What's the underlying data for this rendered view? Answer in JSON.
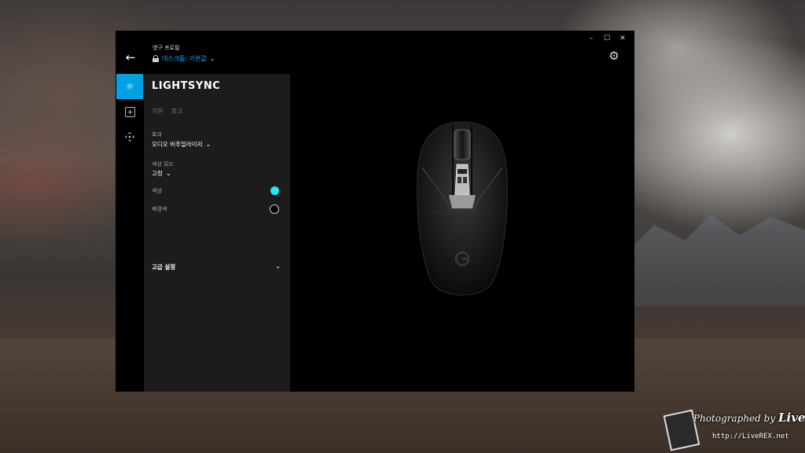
{
  "window": {
    "profile_title": "영구 프로필",
    "profile_name": "데스크톱: 기본값",
    "controls": {
      "minimize": "–",
      "maximize": "☐",
      "close": "✕"
    }
  },
  "panel": {
    "title": "LIGHTSYNC",
    "tabs": [
      {
        "label": "기본"
      },
      {
        "label": "로고"
      }
    ],
    "effect": {
      "label": "효과",
      "value": "오디오 비주얼라이저"
    },
    "color_mode": {
      "label": "색상 모드",
      "value": "고정"
    },
    "color": {
      "label": "색상",
      "hex": "#1fe9f5"
    },
    "background_color": {
      "label": "배경색",
      "hex": "#000000"
    },
    "advanced": {
      "label": "고급 설정"
    }
  },
  "nav_icons": [
    "lighting-icon",
    "assignments-icon",
    "dpi-icon"
  ],
  "accent_color": "#00a2e4",
  "watermark": {
    "signature_prefix": "Photographed by",
    "signature_name": "LiveREX",
    "url": "http://LiveREX.net"
  }
}
